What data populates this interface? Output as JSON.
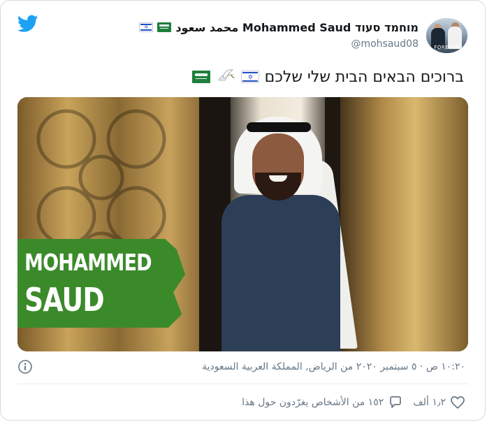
{
  "tweet": {
    "display_name": "محمد سعود Mohammed Saud מוחמד סעוד",
    "handle": "@mohsaud08",
    "text": "ברוכים הבאים הבית שלי שלכם",
    "timestamp_location": "١٠:٢٠ ص · ٥ سبتمبر ٢٠٢٠ من الرياض, المملكة العربية السعودية",
    "likes_count": "١٫٢ ألف",
    "replies_summary": "١٥٢ من الأشخاص يغرّدون حول هذا"
  },
  "avatar": {
    "caption": "FOREVER"
  },
  "photo": {
    "banner_line1": "MOHAMMED",
    "banner_line2": "SAUD"
  },
  "icons": {
    "logo": "twitter-bird-icon",
    "info": "info-icon",
    "like": "heart-icon",
    "reply": "comment-bubble-icon",
    "flag_israel": "israel-flag-icon",
    "flag_saudi": "saudi-flag-icon",
    "dove": "dove-icon"
  },
  "colors": {
    "twitter_blue": "#1da1f2",
    "secondary_text": "#657786",
    "banner_green": "#3b8a2a"
  }
}
